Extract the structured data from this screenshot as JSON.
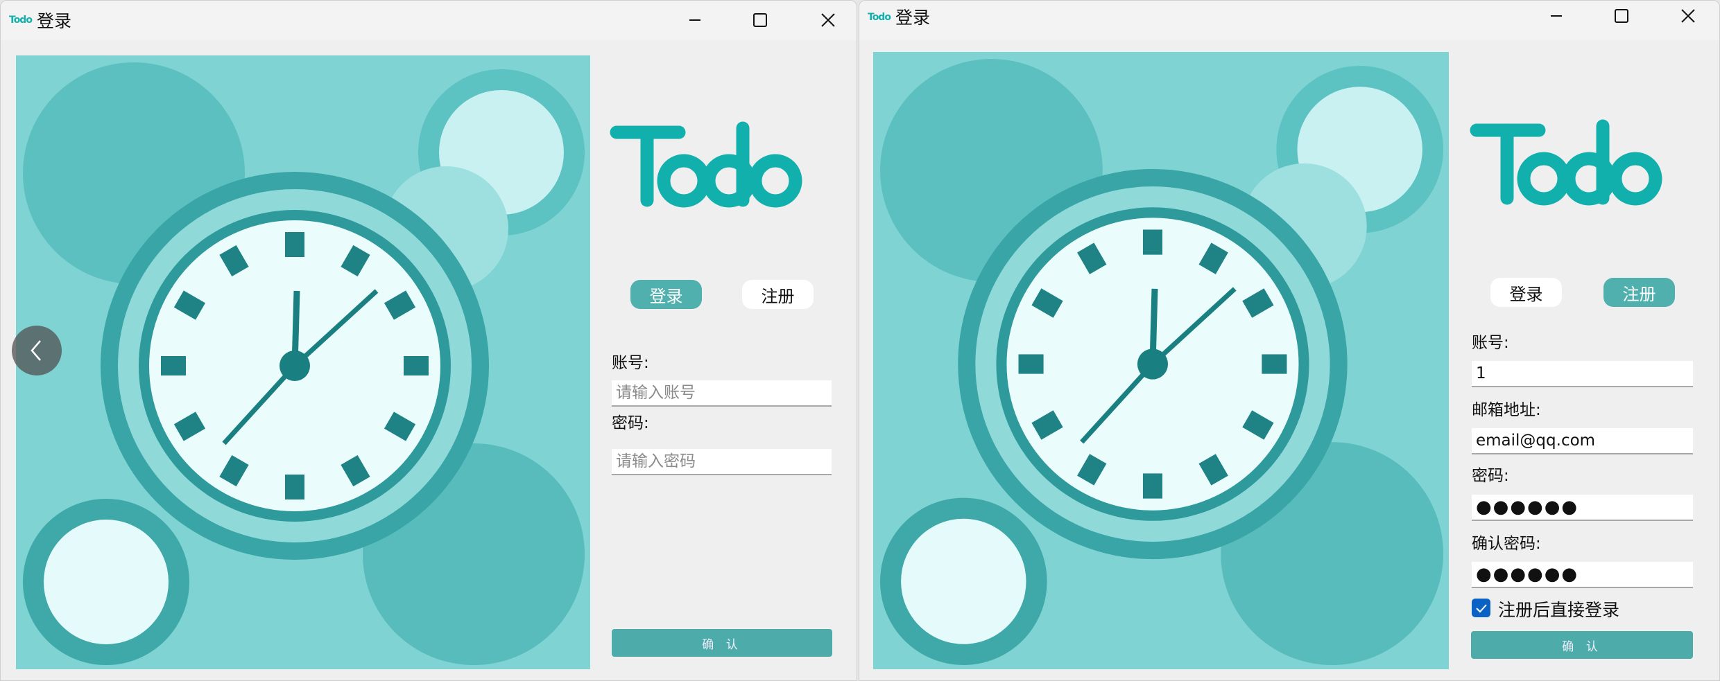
{
  "windows": [
    {
      "title": "登录",
      "brand": "Todo",
      "tabs": {
        "login": "登录",
        "register": "注册",
        "active": "login"
      },
      "fields": {
        "account_label": "账号:",
        "account_placeholder": "请输入账号",
        "password_label": "密码:",
        "password_placeholder": "请输入密码"
      },
      "confirm_label": "确 认"
    },
    {
      "title": "登录",
      "brand": "Todo",
      "tabs": {
        "login": "登录",
        "register": "注册",
        "active": "register"
      },
      "fields": {
        "account_label": "账号:",
        "account_value": "1",
        "email_label": "邮箱地址:",
        "email_value": "email@qq.com",
        "password_label": "密码:",
        "password_value": "●●●●●●",
        "confirm_password_label": "确认密码:",
        "confirm_password_value": "●●●●●●"
      },
      "auto_login_label": "注册后直接登录",
      "auto_login_checked": true,
      "confirm_label": "确 认"
    }
  ],
  "colors": {
    "accent": "#4fb0ae",
    "brand": "#12b0ac",
    "checkbox": "#0b62c4"
  },
  "icons": [
    "todo-logo-icon",
    "minimize-icon",
    "maximize-icon",
    "close-icon",
    "chevron-left-icon",
    "checkmark-icon"
  ]
}
